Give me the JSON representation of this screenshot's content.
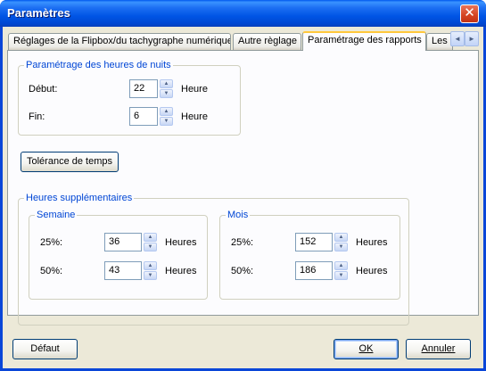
{
  "window": {
    "title": "Paramètres",
    "close_glyph": "✕"
  },
  "tabs": [
    {
      "label": "Réglages de la Flipbox/du tachygraphe numérique"
    },
    {
      "label": "Autre règlage"
    },
    {
      "label": "Paramétrage des rapports",
      "active": true
    },
    {
      "label": "Les"
    }
  ],
  "tab_scroll": {
    "left_icon": "◄",
    "right_icon": "►"
  },
  "night_hours": {
    "legend": "Paramétrage des heures de nuits",
    "start_label": "Début:",
    "start_value": "22",
    "start_unit": "Heure",
    "end_label": "Fin:",
    "end_value": "6",
    "end_unit": "Heure"
  },
  "tolerance_button": "Tolérance de temps",
  "overtime": {
    "legend": "Heures supplémentaires",
    "week": {
      "legend": "Semaine",
      "rows": [
        {
          "label": "25%:",
          "value": "36",
          "unit": "Heures"
        },
        {
          "label": "50%:",
          "value": "43",
          "unit": "Heures"
        }
      ]
    },
    "month": {
      "legend": "Mois",
      "rows": [
        {
          "label": "25%:",
          "value": "152",
          "unit": "Heures"
        },
        {
          "label": "50%:",
          "value": "186",
          "unit": "Heures"
        }
      ]
    }
  },
  "spin": {
    "up_icon": "▲",
    "down_icon": "▼"
  },
  "buttons": {
    "default": "Défaut",
    "ok": "OK",
    "cancel": "Annuler"
  }
}
